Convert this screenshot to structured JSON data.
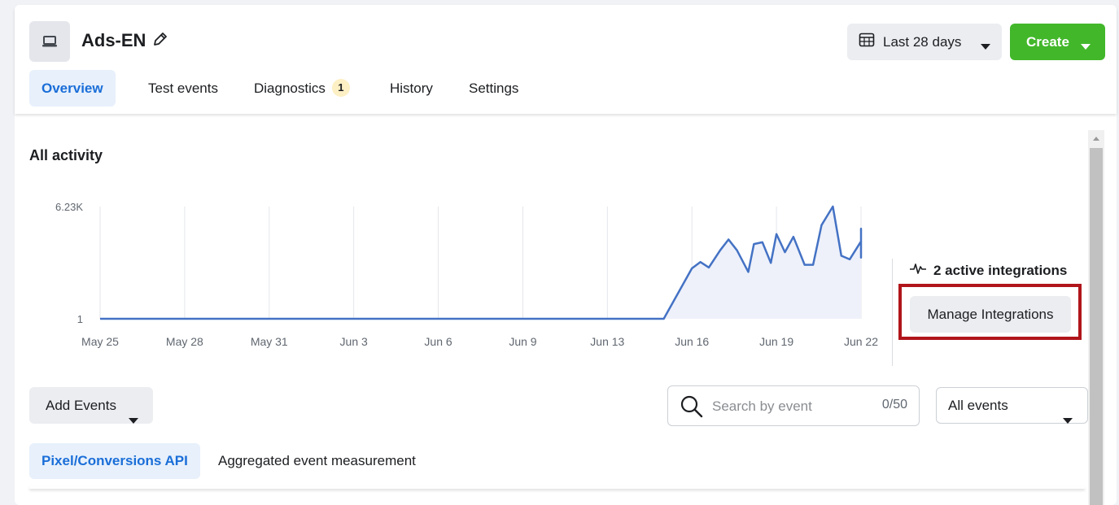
{
  "header": {
    "title": "Ads-EN",
    "app_icon": "laptop-icon",
    "edit_icon": "pencil-icon",
    "date_range": "Last 28 days",
    "create_label": "Create"
  },
  "tabs": [
    {
      "label": "Overview",
      "active": true
    },
    {
      "label": "Test events",
      "active": false
    },
    {
      "label": "Diagnostics",
      "active": false,
      "badge": "1"
    },
    {
      "label": "History",
      "active": false
    },
    {
      "label": "Settings",
      "active": false
    }
  ],
  "activity": {
    "title": "All activity",
    "integrations_label": "2 active integrations",
    "manage_label": "Manage Integrations"
  },
  "chart_data": {
    "type": "area",
    "title": "",
    "xlabel": "",
    "ylabel": "",
    "y_ticks": [
      "6.23K",
      "1"
    ],
    "ylim": [
      1,
      6230
    ],
    "x_ticks": [
      "May 25",
      "May 28",
      "May 31",
      "Jun 3",
      "Jun 6",
      "Jun 9",
      "Jun 13",
      "Jun 16",
      "Jun 19",
      "Jun 22"
    ],
    "grid": true,
    "series_color": "#4472c4",
    "fill_color": "#eef1fa",
    "points": [
      {
        "x": "May 25",
        "y": 1
      },
      {
        "x": "May 28",
        "y": 1
      },
      {
        "x": "May 31",
        "y": 1
      },
      {
        "x": "Jun 3",
        "y": 1
      },
      {
        "x": "Jun 6",
        "y": 1
      },
      {
        "x": "Jun 9",
        "y": 1
      },
      {
        "x": "Jun 13",
        "y": 1
      },
      {
        "x": "Jun 15",
        "y": 1
      },
      {
        "x": "Jun 16",
        "y": 2800
      },
      {
        "x": "Jun 16.3",
        "y": 3150
      },
      {
        "x": "Jun 16.6",
        "y": 2850
      },
      {
        "x": "Jun 17",
        "y": 3800
      },
      {
        "x": "Jun 17.3",
        "y": 4400
      },
      {
        "x": "Jun 17.6",
        "y": 3800
      },
      {
        "x": "Jun 18",
        "y": 2600
      },
      {
        "x": "Jun 18.2",
        "y": 4150
      },
      {
        "x": "Jun 18.5",
        "y": 4250
      },
      {
        "x": "Jun 18.8",
        "y": 3100
      },
      {
        "x": "Jun 19",
        "y": 4700
      },
      {
        "x": "Jun 19.3",
        "y": 3700
      },
      {
        "x": "Jun 19.6",
        "y": 4550
      },
      {
        "x": "Jun 20",
        "y": 3000
      },
      {
        "x": "Jun 20.3",
        "y": 3000
      },
      {
        "x": "Jun 20.6",
        "y": 5200
      },
      {
        "x": "Jun 21",
        "y": 6230
      },
      {
        "x": "Jun 21.3",
        "y": 3500
      },
      {
        "x": "Jun 21.6",
        "y": 3300
      },
      {
        "x": "Jun 22",
        "y": 4300
      },
      {
        "x": "Jun 22.3",
        "y": 5000
      },
      {
        "x": "Jun 22.6",
        "y": 3600
      },
      {
        "x": "Jun 22.8",
        "y": 3400
      },
      {
        "x": "Jun 23",
        "y": 4400
      }
    ]
  },
  "toolbar": {
    "add_events_label": "Add Events",
    "search_placeholder": "Search by event",
    "search_value": "",
    "search_count": "0/50",
    "filter_value": "All events"
  },
  "subtabs": [
    {
      "label": "Pixel/Conversions API",
      "active": true
    },
    {
      "label": "Aggregated event measurement",
      "active": false
    }
  ]
}
